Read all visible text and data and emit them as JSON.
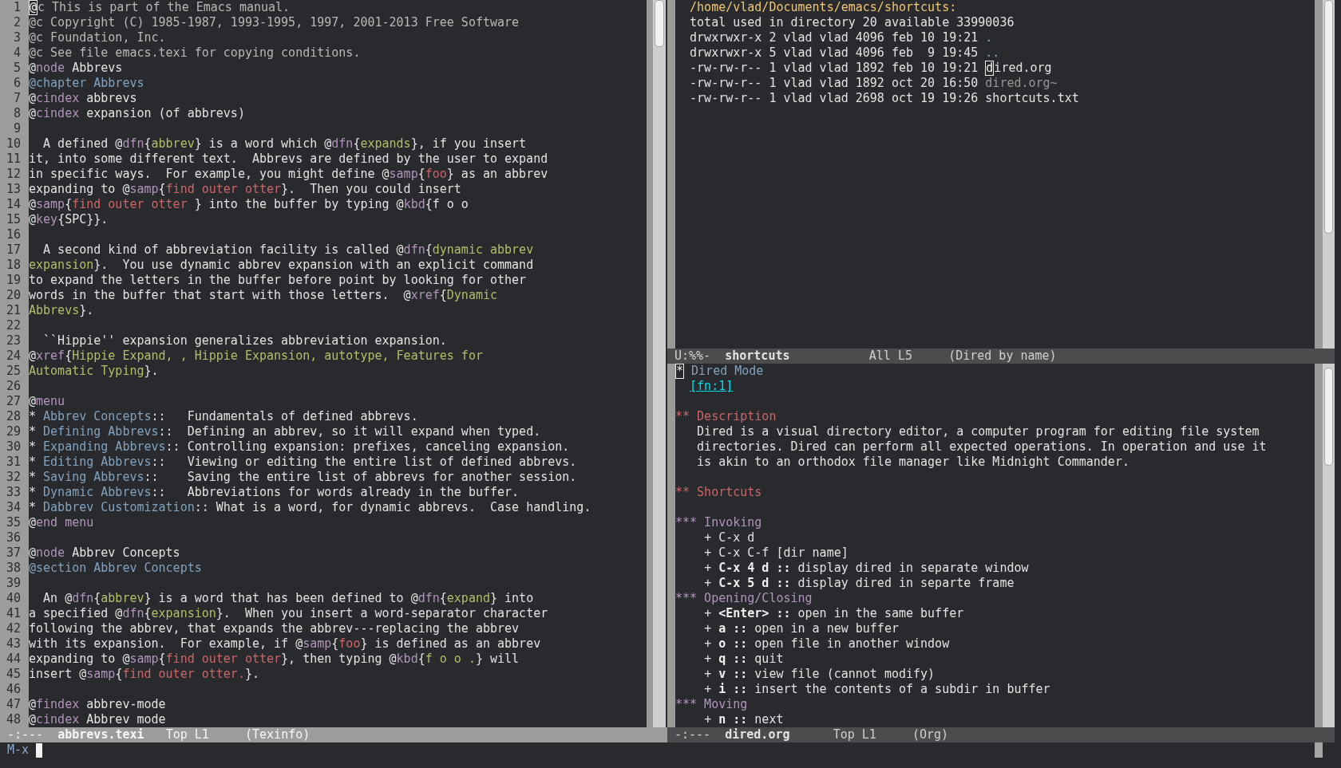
{
  "windows": [
    {
      "kind": "texinfo",
      "lines": [
        {
          "number": "1",
          "segments": [
            {
              "text": "@",
              "kind": "cursor"
            },
            {
              "text": "c This is part of the Emacs manual.",
              "kind": "comment"
            }
          ]
        },
        {
          "number": "2",
          "segments": [
            {
              "text": "@c Copyright (C) 1985-1987, 1993-1995, 1997, 2001-2013 Free Software",
              "kind": "comment"
            }
          ]
        },
        {
          "number": "3",
          "segments": [
            {
              "text": "@c Foundation, Inc.",
              "kind": "comment"
            }
          ]
        },
        {
          "number": "4",
          "segments": [
            {
              "text": "@c See file emacs.texi for copying conditions.",
              "kind": "comment"
            }
          ]
        },
        {
          "number": "5",
          "segments": [
            {
              "text": "@",
              "kind": "plain"
            },
            {
              "text": "node",
              "kind": "keyword"
            },
            {
              "text": " Abbrevs",
              "kind": "plain"
            }
          ]
        },
        {
          "number": "6",
          "segments": [
            {
              "text": "@chapter Abbrevs",
              "kind": "heading"
            }
          ]
        },
        {
          "number": "7",
          "segments": [
            {
              "text": "@",
              "kind": "plain"
            },
            {
              "text": "cindex",
              "kind": "keyword"
            },
            {
              "text": " abbrevs",
              "kind": "plain"
            }
          ]
        },
        {
          "number": "8",
          "segments": [
            {
              "text": "@",
              "kind": "plain"
            },
            {
              "text": "cindex",
              "kind": "keyword"
            },
            {
              "text": " expansion (of abbrevs)",
              "kind": "plain"
            }
          ]
        },
        {
          "number": "9"
        },
        {
          "number": "10",
          "segments": [
            {
              "text": "  A defined @",
              "kind": "plain"
            },
            {
              "text": "dfn",
              "kind": "keyword"
            },
            {
              "text": "{",
              "kind": "plain"
            },
            {
              "text": "abbrev",
              "kind": "argument"
            },
            {
              "text": "} is a word which @",
              "kind": "plain"
            },
            {
              "text": "dfn",
              "kind": "keyword"
            },
            {
              "text": "{",
              "kind": "plain"
            },
            {
              "text": "expands",
              "kind": "argument"
            },
            {
              "text": "}, if you insert",
              "kind": "plain"
            }
          ]
        },
        {
          "number": "11",
          "segments": [
            {
              "text": "it, into some different text.  Abbrevs are defined by the user to expand",
              "kind": "plain"
            }
          ]
        },
        {
          "number": "12",
          "segments": [
            {
              "text": "in specific ways.  For example, you might define @",
              "kind": "plain"
            },
            {
              "text": "samp",
              "kind": "keyword"
            },
            {
              "text": "{",
              "kind": "plain"
            },
            {
              "text": "foo",
              "kind": "sample"
            },
            {
              "text": "} as an abbrev",
              "kind": "plain"
            }
          ]
        },
        {
          "number": "13",
          "segments": [
            {
              "text": "expanding to @",
              "kind": "plain"
            },
            {
              "text": "samp",
              "kind": "keyword"
            },
            {
              "text": "{",
              "kind": "plain"
            },
            {
              "text": "find outer otter",
              "kind": "sample"
            },
            {
              "text": "}.  Then you could insert",
              "kind": "plain"
            }
          ]
        },
        {
          "number": "14",
          "segments": [
            {
              "text": "@",
              "kind": "plain"
            },
            {
              "text": "samp",
              "kind": "keyword"
            },
            {
              "text": "{",
              "kind": "plain"
            },
            {
              "text": "find outer otter",
              "kind": "sample"
            },
            {
              "text": " } into the buffer by typing @",
              "kind": "plain"
            },
            {
              "text": "kbd",
              "kind": "keyword"
            },
            {
              "text": "{f o o",
              "kind": "plain"
            }
          ]
        },
        {
          "number": "15",
          "segments": [
            {
              "text": "@",
              "kind": "plain"
            },
            {
              "text": "key",
              "kind": "keyword"
            },
            {
              "text": "{SPC}}.",
              "kind": "plain"
            }
          ]
        },
        {
          "number": "16"
        },
        {
          "number": "17",
          "segments": [
            {
              "text": "  A second kind of abbreviation facility is called @",
              "kind": "plain"
            },
            {
              "text": "dfn",
              "kind": "keyword"
            },
            {
              "text": "{",
              "kind": "plain"
            },
            {
              "text": "dynamic abbrev",
              "kind": "argument"
            }
          ]
        },
        {
          "number": "18",
          "segments": [
            {
              "text": "expansion",
              "kind": "argument"
            },
            {
              "text": "}.  You use dynamic abbrev expansion with an explicit command",
              "kind": "plain"
            }
          ]
        },
        {
          "number": "19",
          "segments": [
            {
              "text": "to expand the letters in the buffer before point by looking for other",
              "kind": "plain"
            }
          ]
        },
        {
          "number": "20",
          "segments": [
            {
              "text": "words in the buffer that start with those letters.  @",
              "kind": "plain"
            },
            {
              "text": "xref",
              "kind": "keyword"
            },
            {
              "text": "{",
              "kind": "plain"
            },
            {
              "text": "Dynamic",
              "kind": "argument"
            }
          ]
        },
        {
          "number": "21",
          "segments": [
            {
              "text": "Abbrevs",
              "kind": "argument"
            },
            {
              "text": "}.",
              "kind": "plain"
            }
          ]
        },
        {
          "number": "22"
        },
        {
          "number": "23",
          "segments": [
            {
              "text": "  ``Hippie'' expansion generalizes abbreviation expansion.",
              "kind": "plain"
            }
          ]
        },
        {
          "number": "24",
          "segments": [
            {
              "text": "@",
              "kind": "plain"
            },
            {
              "text": "xref",
              "kind": "keyword"
            },
            {
              "text": "{",
              "kind": "plain"
            },
            {
              "text": "Hippie Expand, , Hippie Expansion, autotype, Features for",
              "kind": "argument"
            }
          ]
        },
        {
          "number": "25",
          "segments": [
            {
              "text": "Automatic Typing",
              "kind": "argument"
            },
            {
              "text": "}.",
              "kind": "plain"
            }
          ]
        },
        {
          "number": "26"
        },
        {
          "number": "27",
          "segments": [
            {
              "text": "@",
              "kind": "plain"
            },
            {
              "text": "menu",
              "kind": "keyword"
            }
          ]
        },
        {
          "number": "28",
          "segments": [
            {
              "text": "* ",
              "kind": "plain"
            },
            {
              "text": "Abbrev Concepts",
              "kind": "menu-entry"
            },
            {
              "text": "::   Fundamentals of defined abbrevs.",
              "kind": "plain"
            }
          ]
        },
        {
          "number": "29",
          "segments": [
            {
              "text": "* ",
              "kind": "plain"
            },
            {
              "text": "Defining Abbrevs",
              "kind": "menu-entry"
            },
            {
              "text": "::  Defining an abbrev, so it will expand when typed.",
              "kind": "plain"
            }
          ]
        },
        {
          "number": "30",
          "segments": [
            {
              "text": "* ",
              "kind": "plain"
            },
            {
              "text": "Expanding Abbrevs",
              "kind": "menu-entry"
            },
            {
              "text": ":: Controlling expansion: prefixes, canceling expansion.",
              "kind": "plain"
            }
          ]
        },
        {
          "number": "31",
          "segments": [
            {
              "text": "* ",
              "kind": "plain"
            },
            {
              "text": "Editing Abbrevs",
              "kind": "menu-entry"
            },
            {
              "text": "::   Viewing or editing the entire list of defined abbrevs.",
              "kind": "plain"
            }
          ]
        },
        {
          "number": "32",
          "segments": [
            {
              "text": "* ",
              "kind": "plain"
            },
            {
              "text": "Saving Abbrevs",
              "kind": "menu-entry"
            },
            {
              "text": "::    Saving the entire list of abbrevs for another session.",
              "kind": "plain"
            }
          ]
        },
        {
          "number": "33",
          "segments": [
            {
              "text": "* ",
              "kind": "plain"
            },
            {
              "text": "Dynamic Abbrevs",
              "kind": "menu-entry"
            },
            {
              "text": "::   Abbreviations for words already in the buffer.",
              "kind": "plain"
            }
          ]
        },
        {
          "number": "34",
          "segments": [
            {
              "text": "* ",
              "kind": "plain"
            },
            {
              "text": "Dabbrev Customization",
              "kind": "menu-entry"
            },
            {
              "text": ":: What is a word, for dynamic abbrevs.  Case handling.",
              "kind": "plain"
            }
          ]
        },
        {
          "number": "35",
          "segments": [
            {
              "text": "@",
              "kind": "plain"
            },
            {
              "text": "end menu",
              "kind": "keyword"
            }
          ]
        },
        {
          "number": "36"
        },
        {
          "number": "37",
          "segments": [
            {
              "text": "@",
              "kind": "plain"
            },
            {
              "text": "node",
              "kind": "keyword"
            },
            {
              "text": " Abbrev Concepts",
              "kind": "plain"
            }
          ]
        },
        {
          "number": "38",
          "segments": [
            {
              "text": "@section Abbrev Concepts",
              "kind": "heading"
            }
          ]
        },
        {
          "number": "39"
        },
        {
          "number": "40",
          "segments": [
            {
              "text": "  An @",
              "kind": "plain"
            },
            {
              "text": "dfn",
              "kind": "keyword"
            },
            {
              "text": "{",
              "kind": "plain"
            },
            {
              "text": "abbrev",
              "kind": "argument"
            },
            {
              "text": "} is a word that has been defined to @",
              "kind": "plain"
            },
            {
              "text": "dfn",
              "kind": "keyword"
            },
            {
              "text": "{",
              "kind": "plain"
            },
            {
              "text": "expand",
              "kind": "argument"
            },
            {
              "text": "} into",
              "kind": "plain"
            }
          ]
        },
        {
          "number": "41",
          "segments": [
            {
              "text": "a specified @",
              "kind": "plain"
            },
            {
              "text": "dfn",
              "kind": "keyword"
            },
            {
              "text": "{",
              "kind": "plain"
            },
            {
              "text": "expansion",
              "kind": "argument"
            },
            {
              "text": "}.  When you insert a word-separator character",
              "kind": "plain"
            }
          ]
        },
        {
          "number": "42",
          "segments": [
            {
              "text": "following the abbrev, that expands the abbrev---replacing the abbrev",
              "kind": "plain"
            }
          ]
        },
        {
          "number": "43",
          "segments": [
            {
              "text": "with its expansion.  For example, if @",
              "kind": "plain"
            },
            {
              "text": "samp",
              "kind": "keyword"
            },
            {
              "text": "{",
              "kind": "plain"
            },
            {
              "text": "foo",
              "kind": "sample"
            },
            {
              "text": "} is defined as an abbrev",
              "kind": "plain"
            }
          ]
        },
        {
          "number": "44",
          "segments": [
            {
              "text": "expanding to @",
              "kind": "plain"
            },
            {
              "text": "samp",
              "kind": "keyword"
            },
            {
              "text": "{",
              "kind": "plain"
            },
            {
              "text": "find outer otter",
              "kind": "sample"
            },
            {
              "text": "}, then typing @",
              "kind": "plain"
            },
            {
              "text": "kbd",
              "kind": "keyword"
            },
            {
              "text": "{",
              "kind": "plain"
            },
            {
              "text": "f o o .",
              "kind": "argument"
            },
            {
              "text": "} will",
              "kind": "plain"
            }
          ]
        },
        {
          "number": "45",
          "segments": [
            {
              "text": "insert @",
              "kind": "plain"
            },
            {
              "text": "samp",
              "kind": "keyword"
            },
            {
              "text": "{",
              "kind": "plain"
            },
            {
              "text": "find outer otter.",
              "kind": "sample"
            },
            {
              "text": "}.",
              "kind": "plain"
            }
          ]
        },
        {
          "number": "46"
        },
        {
          "number": "47",
          "segments": [
            {
              "text": "@",
              "kind": "plain"
            },
            {
              "text": "findex",
              "kind": "keyword"
            },
            {
              "text": " abbrev-mode",
              "kind": "plain"
            }
          ]
        },
        {
          "number": "48",
          "segments": [
            {
              "text": "@",
              "kind": "plain"
            },
            {
              "text": "cindex",
              "kind": "keyword"
            },
            {
              "text": " Abbrev mode",
              "kind": "plain"
            }
          ]
        }
      ],
      "mode_line": {
        "status": "-:---",
        "buffer": "abbrevs.texi",
        "position": "Top L1",
        "mode": "(Texinfo)",
        "active": true
      }
    },
    {
      "kind": "dired",
      "lines": [
        {
          "segments": [
            {
              "text": "  /home/vlad/Documents/emacs/shortcuts:",
              "kind": "path"
            }
          ]
        },
        {
          "segments": [
            {
              "text": "  total used in directory 20 available 33990036",
              "kind": "plain"
            }
          ]
        },
        {
          "segments": [
            {
              "text": "  drwxrwxr-x 2 vlad vlad 4096 feb 10 19:21 ",
              "kind": "plain"
            },
            {
              "text": ".",
              "kind": "directory"
            }
          ]
        },
        {
          "segments": [
            {
              "text": "  drwxrwxr-x 5 vlad vlad 4096 feb  9 19:45 ",
              "kind": "plain"
            },
            {
              "text": "..",
              "kind": "directory"
            }
          ]
        },
        {
          "segments": [
            {
              "text": "  -rw-rw-r-- 1 vlad vlad 1892 feb 10 19:21 ",
              "kind": "plain"
            },
            {
              "text": "d",
              "kind": "cursor"
            },
            {
              "text": "ired.org",
              "kind": "plain"
            }
          ]
        },
        {
          "segments": [
            {
              "text": "  -rw-rw-r-- 1 vlad vlad 1892 oct 20 16:50 ",
              "kind": "plain"
            },
            {
              "text": "dired.org~",
              "kind": "backup"
            }
          ]
        },
        {
          "segments": [
            {
              "text": "  -rw-rw-r-- 1 vlad vlad 2698 oct 19 19:26 shortcuts.txt",
              "kind": "plain"
            }
          ]
        }
      ],
      "mode_line": {
        "status": "U:%%-",
        "buffer": "shortcuts",
        "position": "All L5",
        "mode": "(Dired by name)",
        "active": false
      }
    },
    {
      "kind": "org",
      "blocks": [
        {
          "lines": [
            {
              "segments": [
                {
                  "text": "*",
                  "kind": "cursor"
                },
                {
                  "text": " Dired Mode",
                  "kind": "heading-1"
                }
              ]
            },
            {
              "segments": [
                {
                  "text": "  [fn:1]",
                  "kind": "link"
                }
              ]
            }
          ]
        },
        {
          "lines": [
            {
              "segments": [
                {
                  "text": "** Description",
                  "kind": "heading-2"
                }
              ]
            },
            {
              "segments": [
                {
                  "text": "   Dired is a visual directory editor, a computer program for editing file system",
                  "kind": "plain"
                }
              ]
            },
            {
              "segments": [
                {
                  "text": "   directories. Dired can perform all expected operations. In operation and use it",
                  "kind": "plain"
                }
              ]
            },
            {
              "segments": [
                {
                  "text": "   is akin to an orthodox file manager like Midnight Commander.",
                  "kind": "plain"
                }
              ]
            }
          ]
        },
        {
          "lines": [
            {
              "segments": [
                {
                  "text": "** Shortcuts",
                  "kind": "heading-2"
                }
              ]
            }
          ]
        },
        {
          "lines": [
            {
              "segments": [
                {
                  "text": "*** Invoking",
                  "kind": "heading-3"
                }
              ]
            },
            {
              "segments": [
                {
                  "text": "    + C-x d",
                  "kind": "plain"
                }
              ]
            },
            {
              "segments": [
                {
                  "text": "    + C-x C-f [dir name]",
                  "kind": "plain"
                }
              ]
            },
            {
              "segments": [
                {
                  "text": "    + ",
                  "kind": "plain"
                },
                {
                  "text": "C-x 4 d ::",
                  "kind": "bold"
                },
                {
                  "text": " display dired in separate window",
                  "kind": "plain"
                }
              ]
            },
            {
              "segments": [
                {
                  "text": "    + ",
                  "kind": "plain"
                },
                {
                  "text": "C-x 5 d ::",
                  "kind": "bold"
                },
                {
                  "text": " display dired in separte frame",
                  "kind": "plain"
                }
              ]
            },
            {
              "segments": [
                {
                  "text": "*** Opening/Closing",
                  "kind": "heading-3"
                }
              ]
            },
            {
              "segments": [
                {
                  "text": "    + ",
                  "kind": "plain"
                },
                {
                  "text": "<Enter> ::",
                  "kind": "bold"
                },
                {
                  "text": " open in the same buffer",
                  "kind": "plain"
                }
              ]
            },
            {
              "segments": [
                {
                  "text": "    + ",
                  "kind": "plain"
                },
                {
                  "text": "a ::",
                  "kind": "bold"
                },
                {
                  "text": " open in a new buffer",
                  "kind": "plain"
                }
              ]
            },
            {
              "segments": [
                {
                  "text": "    + ",
                  "kind": "plain"
                },
                {
                  "text": "o ::",
                  "kind": "bold"
                },
                {
                  "text": " open file in another window",
                  "kind": "plain"
                }
              ]
            },
            {
              "segments": [
                {
                  "text": "    + ",
                  "kind": "plain"
                },
                {
                  "text": "q ::",
                  "kind": "bold"
                },
                {
                  "text": " quit",
                  "kind": "plain"
                }
              ]
            },
            {
              "segments": [
                {
                  "text": "    + ",
                  "kind": "plain"
                },
                {
                  "text": "v ::",
                  "kind": "bold"
                },
                {
                  "text": " view file (cannot modify)",
                  "kind": "plain"
                }
              ]
            },
            {
              "segments": [
                {
                  "text": "    + ",
                  "kind": "plain"
                },
                {
                  "text": "i ::",
                  "kind": "bold"
                },
                {
                  "text": " insert the contents of a subdir in buffer",
                  "kind": "plain"
                }
              ]
            },
            {
              "segments": [
                {
                  "text": "*** Moving",
                  "kind": "heading-3"
                }
              ]
            },
            {
              "segments": [
                {
                  "text": "    + ",
                  "kind": "plain"
                },
                {
                  "text": "n ::",
                  "kind": "bold"
                },
                {
                  "text": " next",
                  "kind": "plain"
                }
              ]
            }
          ]
        }
      ],
      "mode_line": {
        "status": "-:---",
        "buffer": "dired.org",
        "position": "Top L1",
        "mode": "(Org)",
        "active": false
      }
    }
  ],
  "minibuffer": {
    "prompt": "M-x",
    "cursor": true
  }
}
